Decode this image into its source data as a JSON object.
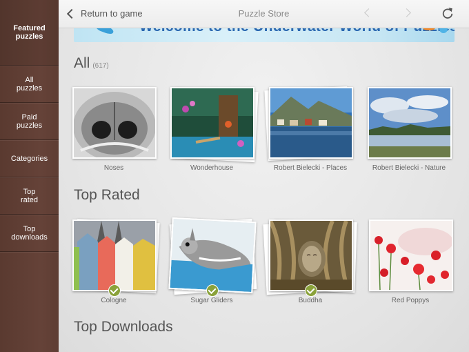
{
  "sidebar": {
    "items": [
      {
        "label": "Featured\npuzzles",
        "selected": true
      },
      {
        "label": "All\npuzzles"
      },
      {
        "label": "Paid\npuzzles"
      },
      {
        "label": "Categories"
      },
      {
        "label": "Top\nrated"
      },
      {
        "label": "Top\ndownloads"
      }
    ]
  },
  "topbar": {
    "back_label": "Return to game",
    "title": "Puzzle Store"
  },
  "banner": {
    "text": "Welcome to the Underwater World of Puzzles"
  },
  "sections": {
    "all": {
      "title": "All",
      "count": "(617)",
      "items": [
        {
          "label": "Noses"
        },
        {
          "label": "Wonderhouse"
        },
        {
          "label": "Robert Bielecki - Places"
        },
        {
          "label": "Robert Bielecki - Nature"
        }
      ]
    },
    "top_rated": {
      "title": "Top Rated",
      "items": [
        {
          "label": "Cologne",
          "owned": true
        },
        {
          "label": "Sugar Gliders",
          "owned": true
        },
        {
          "label": "Buddha",
          "owned": true
        },
        {
          "label": "Red Poppys",
          "owned": false
        }
      ]
    },
    "top_downloads": {
      "title": "Top Downloads"
    }
  },
  "colors": {
    "sidebar": "#5e3d33",
    "check": "#8aa23a",
    "banner_text": "#2a67b0"
  }
}
